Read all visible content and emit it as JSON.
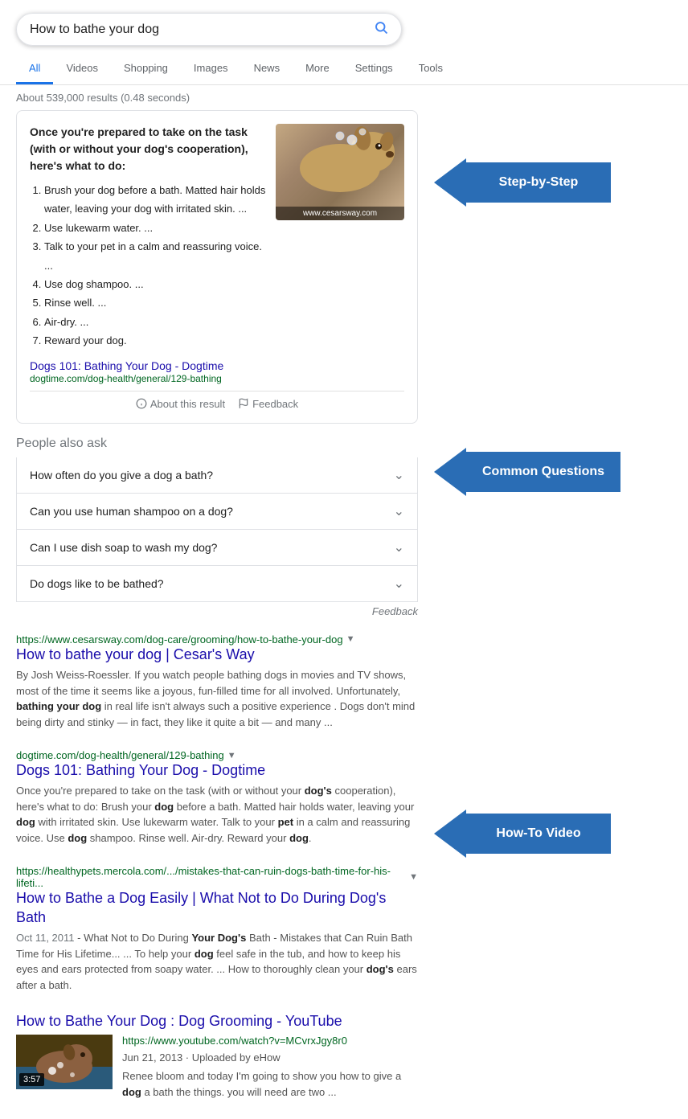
{
  "search": {
    "query": "How to bathe your dog",
    "placeholder": "How to bathe your dog",
    "result_count": "About 539,000 results (0.48 seconds)"
  },
  "nav": {
    "tabs": [
      {
        "label": "All",
        "active": true
      },
      {
        "label": "Videos"
      },
      {
        "label": "Shopping"
      },
      {
        "label": "Images"
      },
      {
        "label": "News"
      },
      {
        "label": "More"
      },
      {
        "label": "Settings"
      },
      {
        "label": "Tools"
      }
    ]
  },
  "featured_snippet": {
    "intro": "Once you're prepared to take on the task (with or without your dog's cooperation), here's what to do:",
    "steps": [
      "Brush your dog before a bath. Matted hair holds water, leaving your dog with irritated skin. ...",
      "Use lukewarm water. ...",
      "Talk to your pet in a calm and reassuring voice. ...",
      "Use dog shampoo. ...",
      "Rinse well. ...",
      "Air-dry. ...",
      "Reward your dog."
    ],
    "image_caption": "www.cesarsway.com",
    "link_title": "Dogs 101: Bathing Your Dog - Dogtime",
    "link_url": "dogtime.com/dog-health/general/129-bathing",
    "about_label": "About this result",
    "feedback_label": "Feedback"
  },
  "paa": {
    "title": "People also ask",
    "questions": [
      "How often do you give a dog a bath?",
      "Can you use human shampoo on a dog?",
      "Can I use dish soap to wash my dog?",
      "Do dogs like to be bathed?"
    ],
    "feedback_label": "Feedback"
  },
  "results": [
    {
      "title": "How to bathe your dog | Cesar's Way",
      "url": "https://www.cesarsway.com/dog-care/grooming/how-to-bathe-your-dog",
      "desc": "By Josh Weiss-Roessler. If you watch people bathing dogs in movies and TV shows, most of the time it seems like a joyous, fun-filled time for all involved. Unfortunately, bathing your dog in real life isn't always such a positive experience . Dogs don't mind being dirty and stinky — in fact, they like it quite a bit — and many ..."
    },
    {
      "title": "Dogs 101: Bathing Your Dog - Dogtime",
      "url": "dogtime.com/dog-health/general/129-bathing",
      "desc": "Once you're prepared to take on the task (with or without your dog's cooperation), here's what to do: Brush your dog before a bath. Matted hair holds water, leaving your dog with irritated skin. Use lukewarm water. Talk to your pet in a calm and reassuring voice. Use dog shampoo. Rinse well. Air-dry. Reward your dog."
    },
    {
      "title": "How to Bathe a Dog Easily | What Not to Do During Dog's Bath",
      "url": "https://healthypets.mercola.com/.../mistakes-that-can-ruin-dogs-bath-time-for-his-lifeti...",
      "date": "Oct 11, 2011",
      "desc": "- What Not to Do During Your Dog's Bath - Mistakes that Can Ruin Bath Time for His Lifetime... ... To help your dog feel safe in the tub, and how to keep his eyes and ears protected from soapy water. ... How to thoroughly clean your dog's ears after a bath."
    }
  ],
  "video_result": {
    "title": "How to Bathe Your Dog : Dog Grooming - YouTube",
    "url": "https://www.youtube.com/watch?v=MCvrxJgy8r0",
    "duration": "3:57",
    "date": "Jun 21, 2013",
    "uploader": "eHow",
    "desc": "Renee bloom and today I'm going to show you how to give a dog a bath the things. you will need are two ..."
  },
  "annotations": {
    "step_by_step": "Step-by-Step",
    "common_questions": "Common Questions",
    "how_to_video": "How-To Video"
  }
}
